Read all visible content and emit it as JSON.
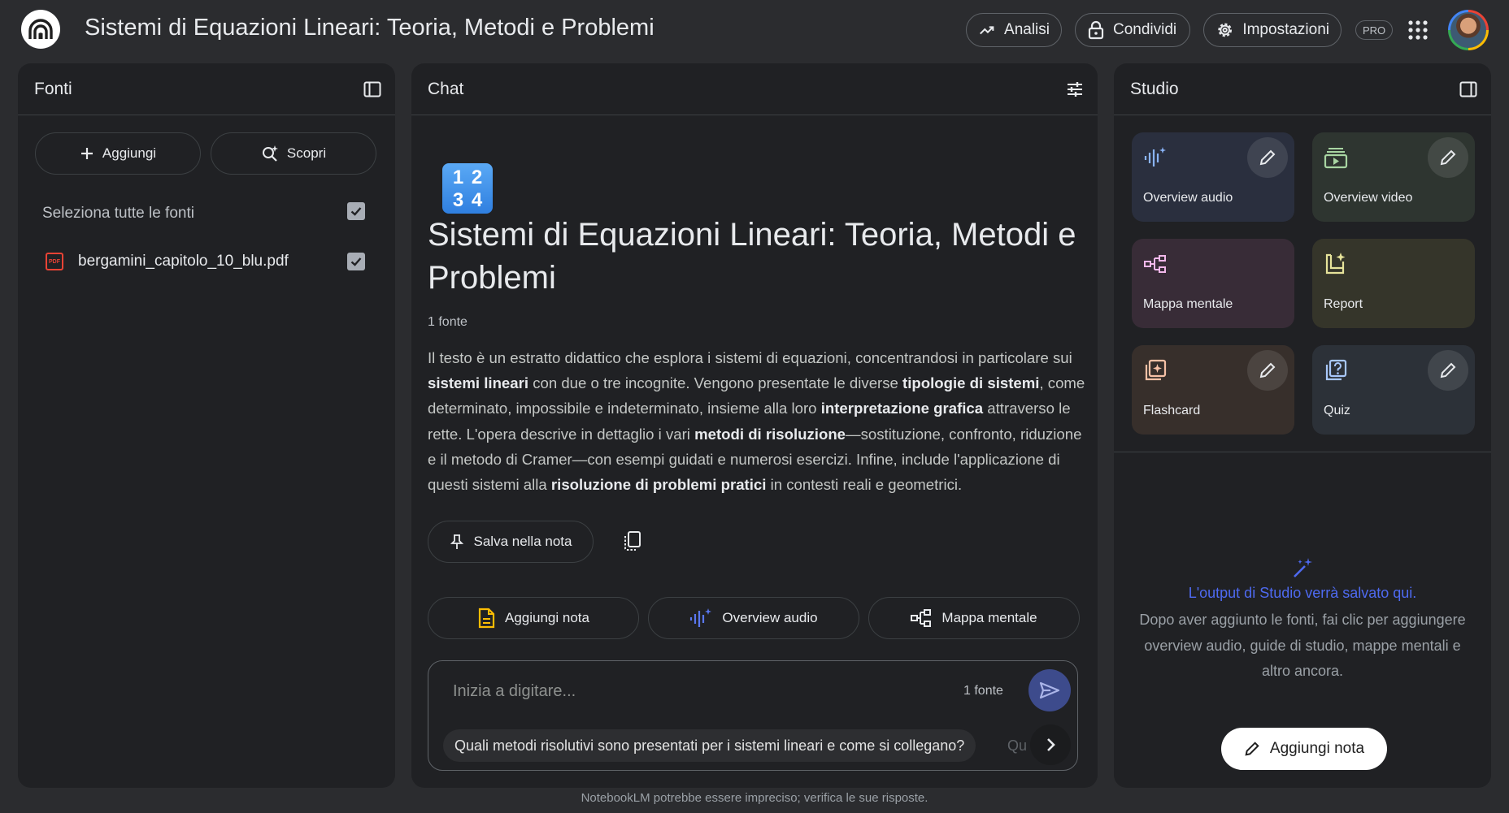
{
  "header": {
    "title": "Sistemi di Equazioni Lineari: Teoria, Metodi e Problemi",
    "analytics_label": "Analisi",
    "share_label": "Condividi",
    "settings_label": "Impostazioni",
    "pro_badge": "PRO",
    "icons": [
      "notebooklm-logo-icon",
      "trending-up-icon",
      "lock-icon",
      "gear-icon",
      "apps-grid-icon",
      "avatar"
    ]
  },
  "sources": {
    "title": "Fonti",
    "add_label": "Aggiungi",
    "discover_label": "Scopri",
    "select_all_label": "Seleziona tutte le fonti",
    "select_all_checked": true,
    "items": [
      {
        "name": "bergamini_capitolo_10_blu.pdf",
        "type_icon": "pdf-icon",
        "checked": true
      }
    ]
  },
  "chat": {
    "title": "Chat",
    "emoji_digits": [
      "1",
      "2",
      "3",
      "4"
    ],
    "notebook_title": "Sistemi di Equazioni Lineari: Teoria, Metodi e Problemi",
    "source_count": "1 fonte",
    "summary": [
      {
        "text": "Il testo è un estratto didattico che esplora i sistemi di equazioni, concentrandosi in particolare sui ",
        "bold": false
      },
      {
        "text": "sistemi lineari",
        "bold": true
      },
      {
        "text": " con due o tre incognite. Vengono presentate le diverse ",
        "bold": false
      },
      {
        "text": "tipologie di sistemi",
        "bold": true
      },
      {
        "text": ", come determinato, impossibile e indeterminato, insieme alla loro ",
        "bold": false
      },
      {
        "text": "interpretazione grafica",
        "bold": true
      },
      {
        "text": " attraverso le rette. L'opera descrive in dettaglio i vari ",
        "bold": false
      },
      {
        "text": "metodi di risoluzione",
        "bold": true
      },
      {
        "text": "—sostituzione, confronto, riduzione e il metodo di Cramer—con esempi guidati e numerosi esercizi. Infine, include l'applicazione di questi sistemi alla ",
        "bold": false
      },
      {
        "text": "risoluzione di problemi pratici",
        "bold": true
      },
      {
        "text": " in contesti reali e geometrici.",
        "bold": false
      }
    ],
    "save_note_label": "Salva nella nota",
    "quick_actions": {
      "add_note": "Aggiungi nota",
      "audio_overview": "Overview audio",
      "mind_map": "Mappa mentale"
    },
    "input_placeholder": "Inizia a digitare...",
    "input_source_count": "1 fonte",
    "suggestion": "Quali metodi risolutivi sono presentati per i sistemi lineari e come si collegano?",
    "suggestion_next_fragment": "Qu"
  },
  "studio": {
    "title": "Studio",
    "tiles": {
      "audio": "Overview audio",
      "video": "Overview video",
      "mindmap": "Mappa mentale",
      "report": "Report",
      "flashcard": "Flashcard",
      "quiz": "Quiz"
    },
    "empty_title": "L'output di Studio verrà salvato qui.",
    "empty_desc": "Dopo aver aggiunto le fonti, fai clic per aggiungere overview audio, guide di studio, mappe mentali e altro ancora.",
    "add_note_label": "Aggiungi nota"
  },
  "footer": {
    "disclaimer": "NotebookLM potrebbe essere impreciso; verifica le sue risposte."
  },
  "colors": {
    "background": "#2b2c2f",
    "panel": "#202124",
    "accent_blue": "#4e6af0",
    "audio_tile": "#2a2f3e",
    "video_tile": "#2e3530",
    "mindmap_tile": "#382c37",
    "report_tile": "#35352a",
    "flashcard_tile": "#372f2b",
    "quiz_tile": "#2c3138"
  }
}
